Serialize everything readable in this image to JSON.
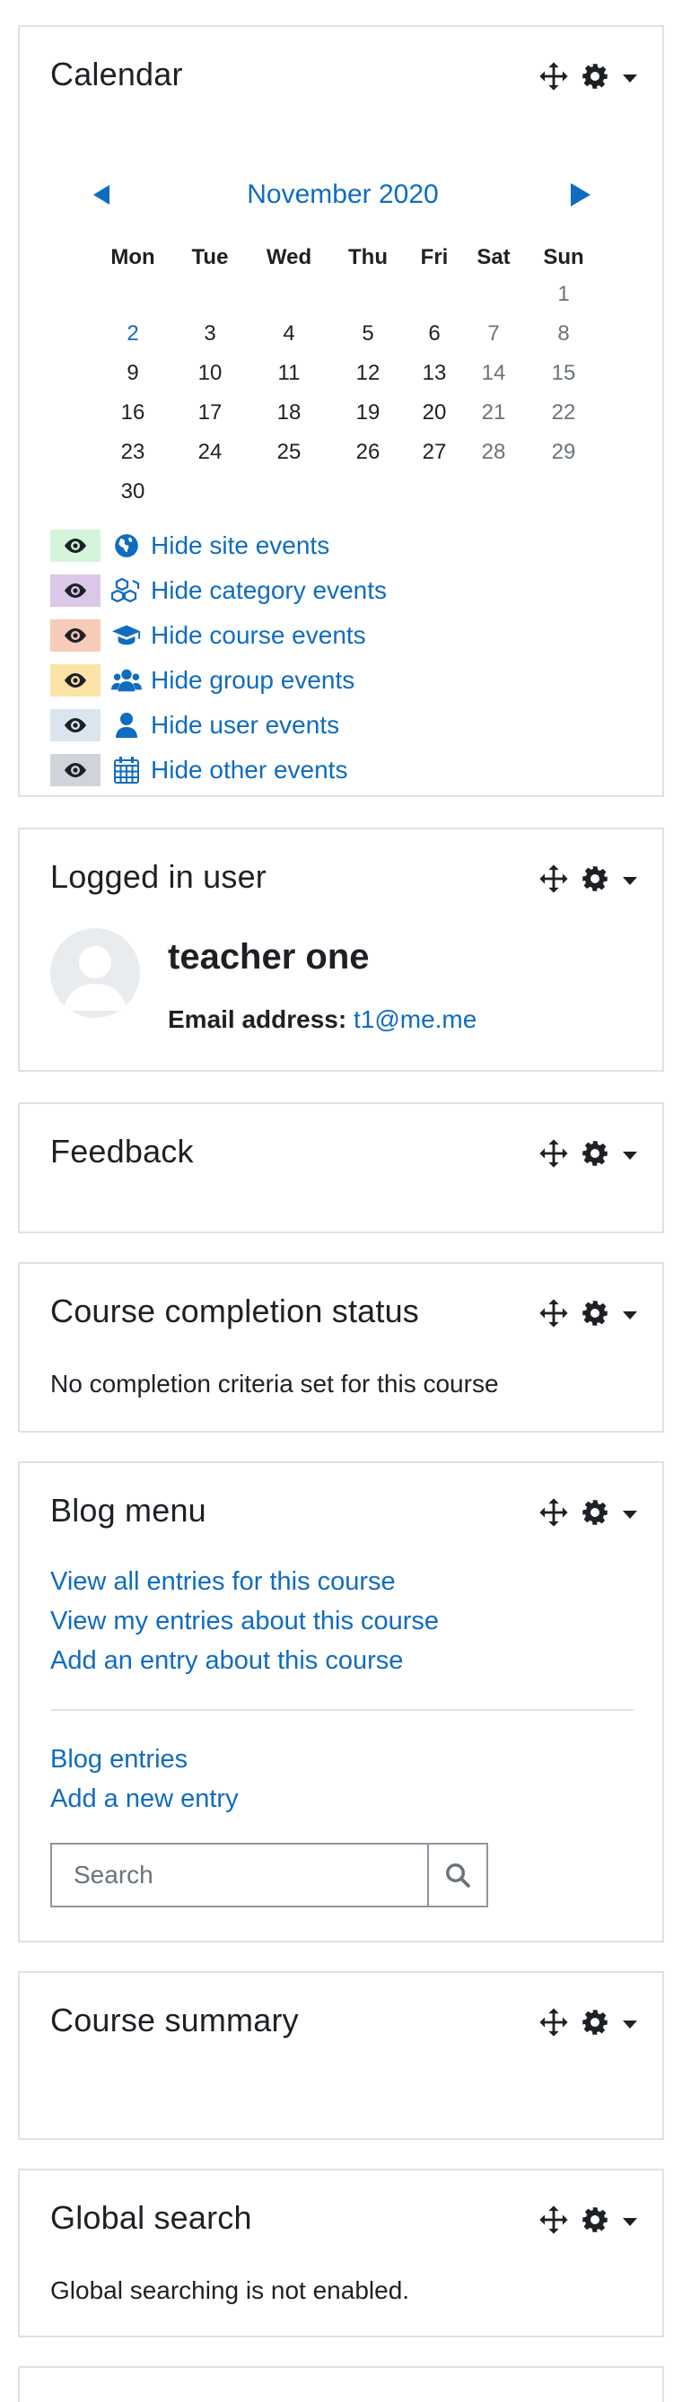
{
  "calendar": {
    "title": "Calendar",
    "month": "November 2020",
    "weekdays": [
      "Mon",
      "Tue",
      "Wed",
      "Thu",
      "Fri",
      "Sat",
      "Sun"
    ],
    "weeks": [
      [
        "",
        "",
        "",
        "",
        "",
        "",
        "1"
      ],
      [
        "2",
        "3",
        "4",
        "5",
        "6",
        "7",
        "8"
      ],
      [
        "9",
        "10",
        "11",
        "12",
        "13",
        "14",
        "15"
      ],
      [
        "16",
        "17",
        "18",
        "19",
        "20",
        "21",
        "22"
      ],
      [
        "23",
        "24",
        "25",
        "26",
        "27",
        "28",
        "29"
      ],
      [
        "30",
        "",
        "",
        "",
        "",
        "",
        ""
      ]
    ],
    "linked_day": "2",
    "legend": [
      {
        "label": "Hide site events",
        "icon": "globe-icon",
        "color": "#d3f5dc"
      },
      {
        "label": "Hide category events",
        "icon": "cubes-icon",
        "color": "#dbc8e8"
      },
      {
        "label": "Hide course events",
        "icon": "graduation-cap-icon",
        "color": "#f6cbb8"
      },
      {
        "label": "Hide group events",
        "icon": "users-icon",
        "color": "#fce3a8"
      },
      {
        "label": "Hide user events",
        "icon": "user-icon",
        "color": "#dae5ef"
      },
      {
        "label": "Hide other events",
        "icon": "calendar-icon",
        "color": "#cfd4da"
      }
    ]
  },
  "logged_in_user": {
    "title": "Logged in user",
    "name": "teacher one",
    "email_label": "Email address:",
    "email": "t1@me.me"
  },
  "feedback": {
    "title": "Feedback"
  },
  "completion": {
    "title": "Course completion status",
    "text": "No completion criteria set for this course"
  },
  "blog": {
    "title": "Blog menu",
    "links": [
      "View all entries for this course",
      "View my entries about this course",
      "Add an entry about this course"
    ],
    "links2": [
      "Blog entries",
      "Add a new entry"
    ],
    "search_placeholder": "Search"
  },
  "summary": {
    "title": "Course summary"
  },
  "global_search": {
    "title": "Global search",
    "text": "Global searching is not enabled."
  },
  "colors": {
    "link": "#0f6cbf",
    "border": "#dee2e6",
    "text": "#1d2125",
    "muted": "#6a737b"
  }
}
